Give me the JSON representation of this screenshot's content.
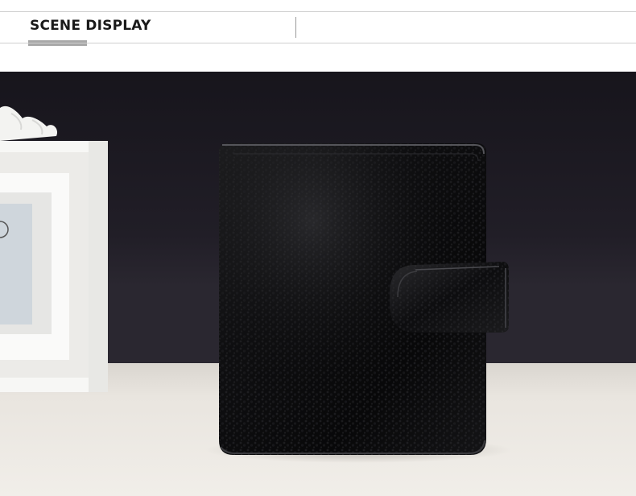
{
  "header": {
    "title": "SCENE DISPLAY"
  },
  "scene": {
    "subject": "black-pebbled-leather-wallet",
    "colors": {
      "backdrop": "#1c1a22",
      "tabletop": "#ece8e2",
      "wallet": "#0b0b0c",
      "frame": "#f7f7f5"
    }
  }
}
